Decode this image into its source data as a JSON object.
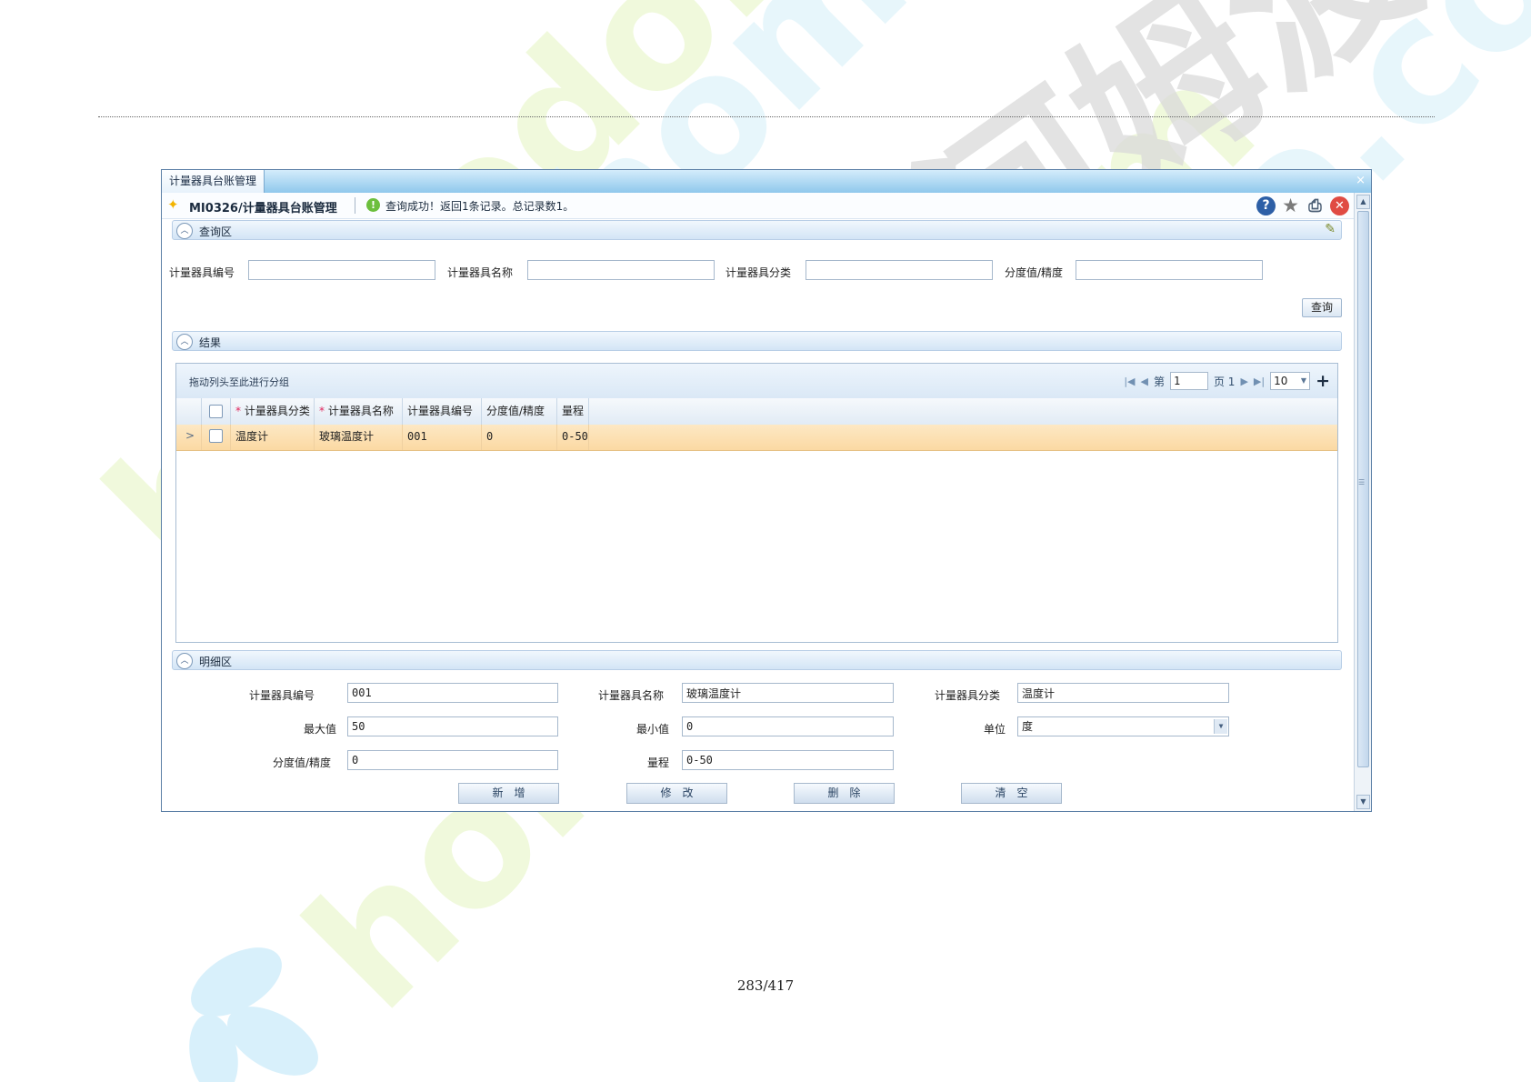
{
  "window": {
    "tab_title": "计量器具台账管理",
    "close_glyph": "×"
  },
  "toolbar": {
    "module_title": "MI0326/计量器具台账管理",
    "status_message": "查询成功！返回1条记录。总记录数1。",
    "icons": [
      "help-icon",
      "star-icon",
      "print-icon",
      "exit-icon"
    ]
  },
  "query_section": {
    "title": "查询区",
    "fields": [
      {
        "label": "计量器具编号",
        "value": ""
      },
      {
        "label": "计量器具名称",
        "value": ""
      },
      {
        "label": "计量器具分类",
        "value": ""
      },
      {
        "label": "分度值/精度",
        "value": ""
      }
    ],
    "query_button": "查询"
  },
  "result_section": {
    "title": "结果",
    "group_hint": "拖动列头至此进行分组",
    "pager": {
      "page_prefix": "第",
      "page_value": "1",
      "page_suffix": "页 1",
      "page_size": "10"
    },
    "columns": [
      {
        "label": "计量器具分类",
        "required": true
      },
      {
        "label": "计量器具名称",
        "required": true
      },
      {
        "label": "计量器具编号",
        "required": false
      },
      {
        "label": "分度值/精度",
        "required": false
      },
      {
        "label": "量程",
        "required": false
      }
    ],
    "rows": [
      {
        "category": "温度计",
        "name": "玻璃温度计",
        "code": "001",
        "resolution": "0",
        "range": "0-50"
      }
    ]
  },
  "detail_section": {
    "title": "明细区",
    "fields": {
      "code": {
        "label": "计量器具编号",
        "value": "001"
      },
      "name": {
        "label": "计量器具名称",
        "value": "玻璃温度计"
      },
      "category": {
        "label": "计量器具分类",
        "value": "温度计"
      },
      "max": {
        "label": "最大值",
        "value": "50"
      },
      "min": {
        "label": "最小值",
        "value": "0"
      },
      "unit": {
        "label": "单位",
        "value": "度"
      },
      "resolution": {
        "label": "分度值/精度",
        "value": "0"
      },
      "range": {
        "label": "量程",
        "value": "0-50"
      }
    },
    "buttons": {
      "add": "新增",
      "edit": "修改",
      "delete": "删除",
      "clear": "清空"
    }
  },
  "page_number": "283/417",
  "watermark": {
    "text": "homedo.com",
    "brand": "河姆渡"
  }
}
